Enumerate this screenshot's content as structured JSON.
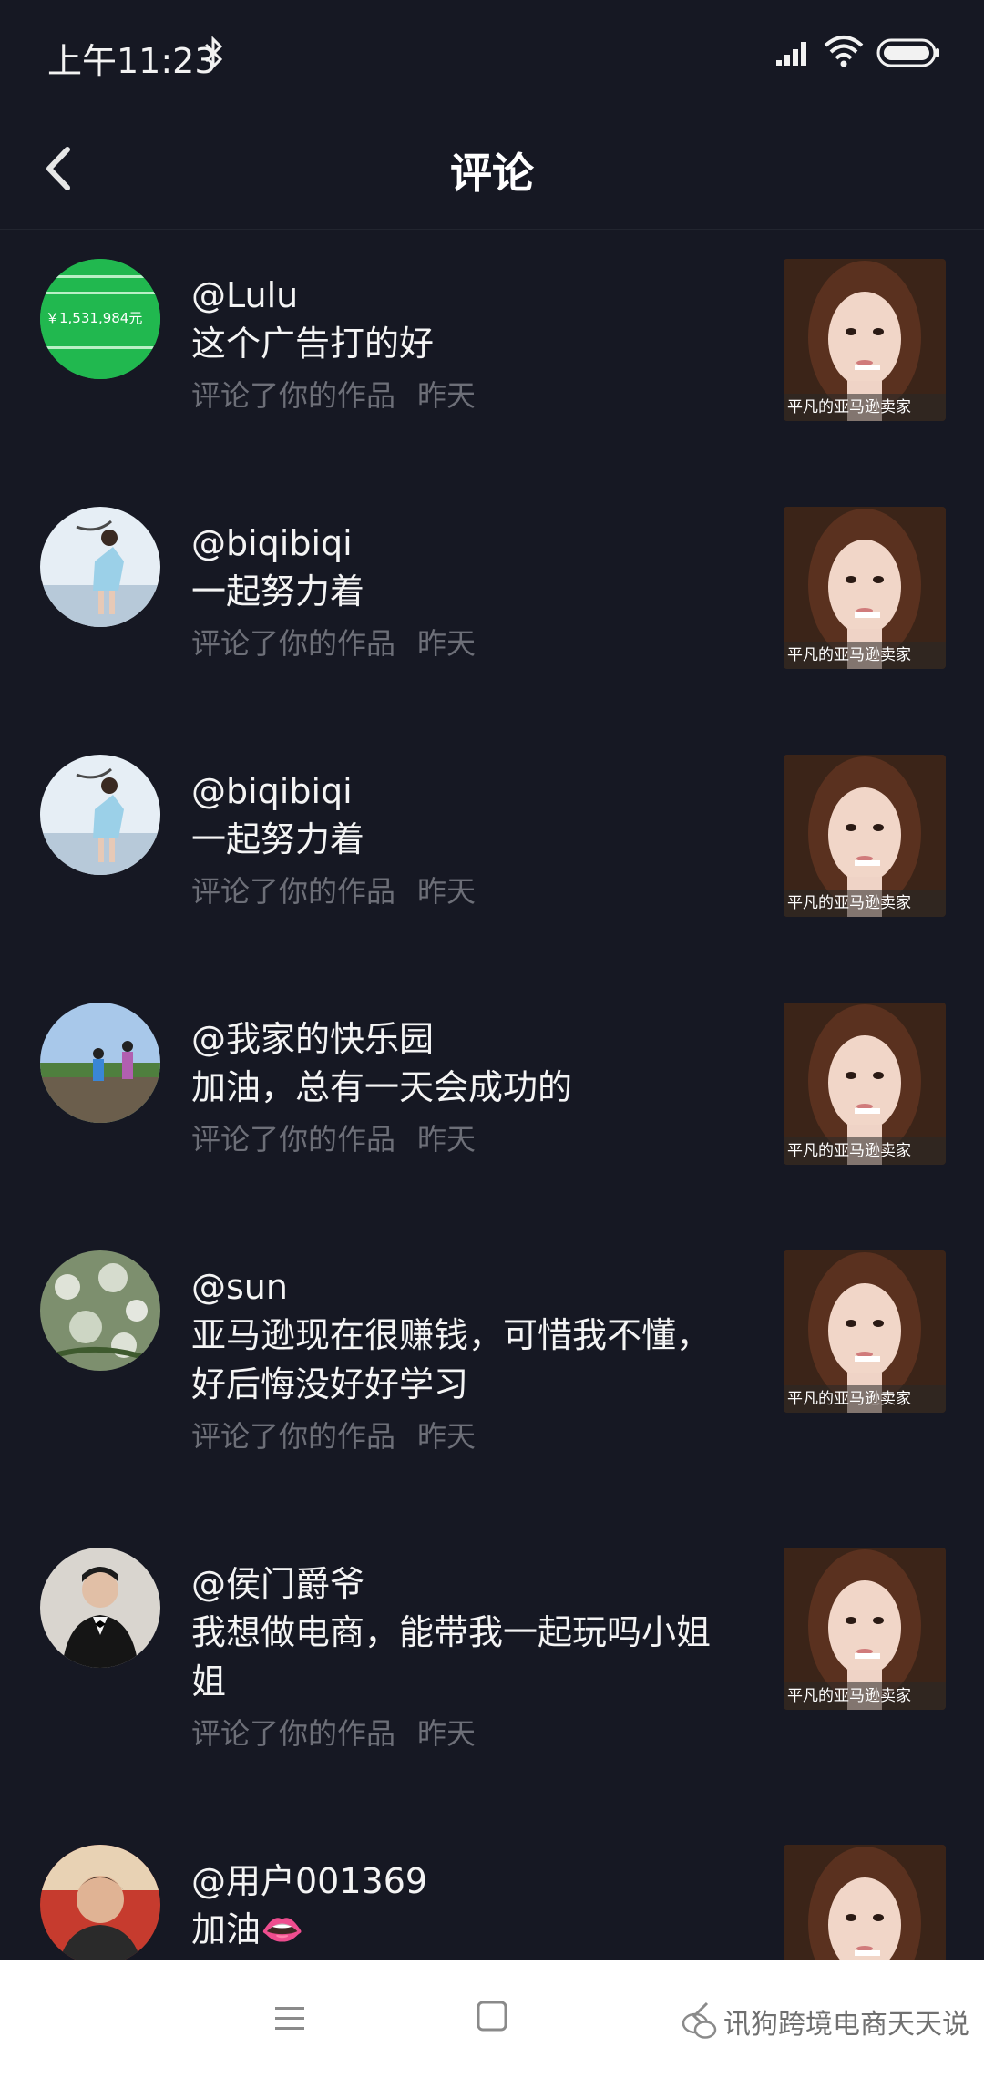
{
  "status_bar": {
    "time": "上午11:23"
  },
  "header": {
    "title": "评论"
  },
  "thumbnail_caption": "平凡的亚马逊卖家",
  "comments": [
    {
      "username": "@Lulu",
      "text": "这个广告打的好",
      "action": "评论了你的作品",
      "time": "昨天",
      "avatar_amount": "￥1,531,984元"
    },
    {
      "username": "@biqibiqi",
      "text": "一起努力着",
      "action": "评论了你的作品",
      "time": "昨天"
    },
    {
      "username": "@biqibiqi",
      "text": "一起努力着",
      "action": "评论了你的作品",
      "time": "昨天"
    },
    {
      "username": "@我家的快乐园",
      "text": "加油，总有一天会成功的",
      "action": "评论了你的作品",
      "time": "昨天"
    },
    {
      "username": "@sun",
      "text": "亚马逊现在很赚钱，可惜我不懂，好后悔没好好学习",
      "action": "评论了你的作品",
      "time": "昨天"
    },
    {
      "username": "@侯门爵爷",
      "text": "我想做电商，能带我一起玩吗小姐姐",
      "action": "评论了你的作品",
      "time": "昨天"
    },
    {
      "username": "@用户001369",
      "text": "加油👄",
      "action": "",
      "time": ""
    }
  ],
  "watermark": "讯狗跨境电商天天说",
  "colors": {
    "background": "#161823",
    "meta_text": "#6d6f78",
    "nav_background": "#ffffff"
  }
}
